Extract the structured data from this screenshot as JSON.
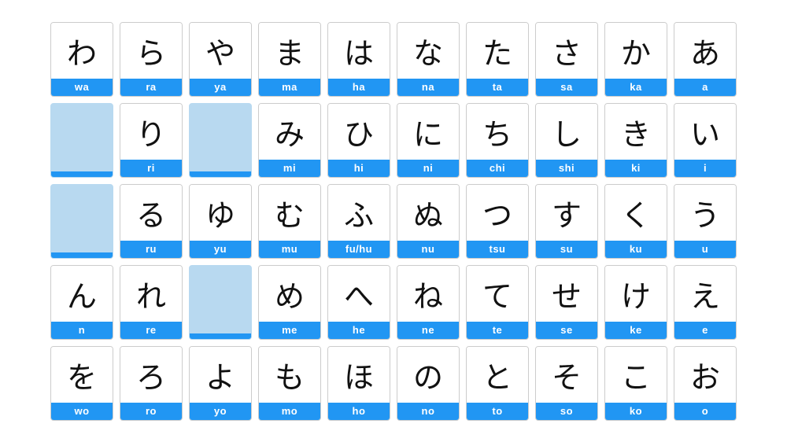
{
  "rows": [
    [
      {
        "char": "わ",
        "roman": "wa"
      },
      {
        "char": "ら",
        "roman": "ra"
      },
      {
        "char": "や",
        "roman": "ya"
      },
      {
        "char": "ま",
        "roman": "ma"
      },
      {
        "char": "は",
        "roman": "ha"
      },
      {
        "char": "な",
        "roman": "na"
      },
      {
        "char": "た",
        "roman": "ta"
      },
      {
        "char": "さ",
        "roman": "sa"
      },
      {
        "char": "か",
        "roman": "ka"
      },
      {
        "char": "あ",
        "roman": "a"
      }
    ],
    [
      {
        "char": "",
        "roman": "",
        "empty": true
      },
      {
        "char": "り",
        "roman": "ri"
      },
      {
        "char": "",
        "roman": "",
        "empty": true
      },
      {
        "char": "み",
        "roman": "mi"
      },
      {
        "char": "ひ",
        "roman": "hi"
      },
      {
        "char": "に",
        "roman": "ni"
      },
      {
        "char": "ち",
        "roman": "chi"
      },
      {
        "char": "し",
        "roman": "shi"
      },
      {
        "char": "き",
        "roman": "ki"
      },
      {
        "char": "い",
        "roman": "i"
      }
    ],
    [
      {
        "char": "",
        "roman": "",
        "empty": true
      },
      {
        "char": "る",
        "roman": "ru"
      },
      {
        "char": "ゆ",
        "roman": "yu"
      },
      {
        "char": "む",
        "roman": "mu"
      },
      {
        "char": "ふ",
        "roman": "fu/hu"
      },
      {
        "char": "ぬ",
        "roman": "nu"
      },
      {
        "char": "つ",
        "roman": "tsu"
      },
      {
        "char": "す",
        "roman": "su"
      },
      {
        "char": "く",
        "roman": "ku"
      },
      {
        "char": "う",
        "roman": "u"
      }
    ],
    [
      {
        "char": "ん",
        "roman": "n"
      },
      {
        "char": "れ",
        "roman": "re"
      },
      {
        "char": "",
        "roman": "",
        "empty": true
      },
      {
        "char": "め",
        "roman": "me"
      },
      {
        "char": "へ",
        "roman": "he"
      },
      {
        "char": "ね",
        "roman": "ne"
      },
      {
        "char": "て",
        "roman": "te"
      },
      {
        "char": "せ",
        "roman": "se"
      },
      {
        "char": "け",
        "roman": "ke"
      },
      {
        "char": "え",
        "roman": "e"
      }
    ],
    [
      {
        "char": "を",
        "roman": "wo"
      },
      {
        "char": "ろ",
        "roman": "ro"
      },
      {
        "char": "よ",
        "roman": "yo"
      },
      {
        "char": "も",
        "roman": "mo"
      },
      {
        "char": "ほ",
        "roman": "ho"
      },
      {
        "char": "の",
        "roman": "no"
      },
      {
        "char": "と",
        "roman": "to"
      },
      {
        "char": "そ",
        "roman": "so"
      },
      {
        "char": "こ",
        "roman": "ko"
      },
      {
        "char": "お",
        "roman": "o"
      }
    ]
  ]
}
